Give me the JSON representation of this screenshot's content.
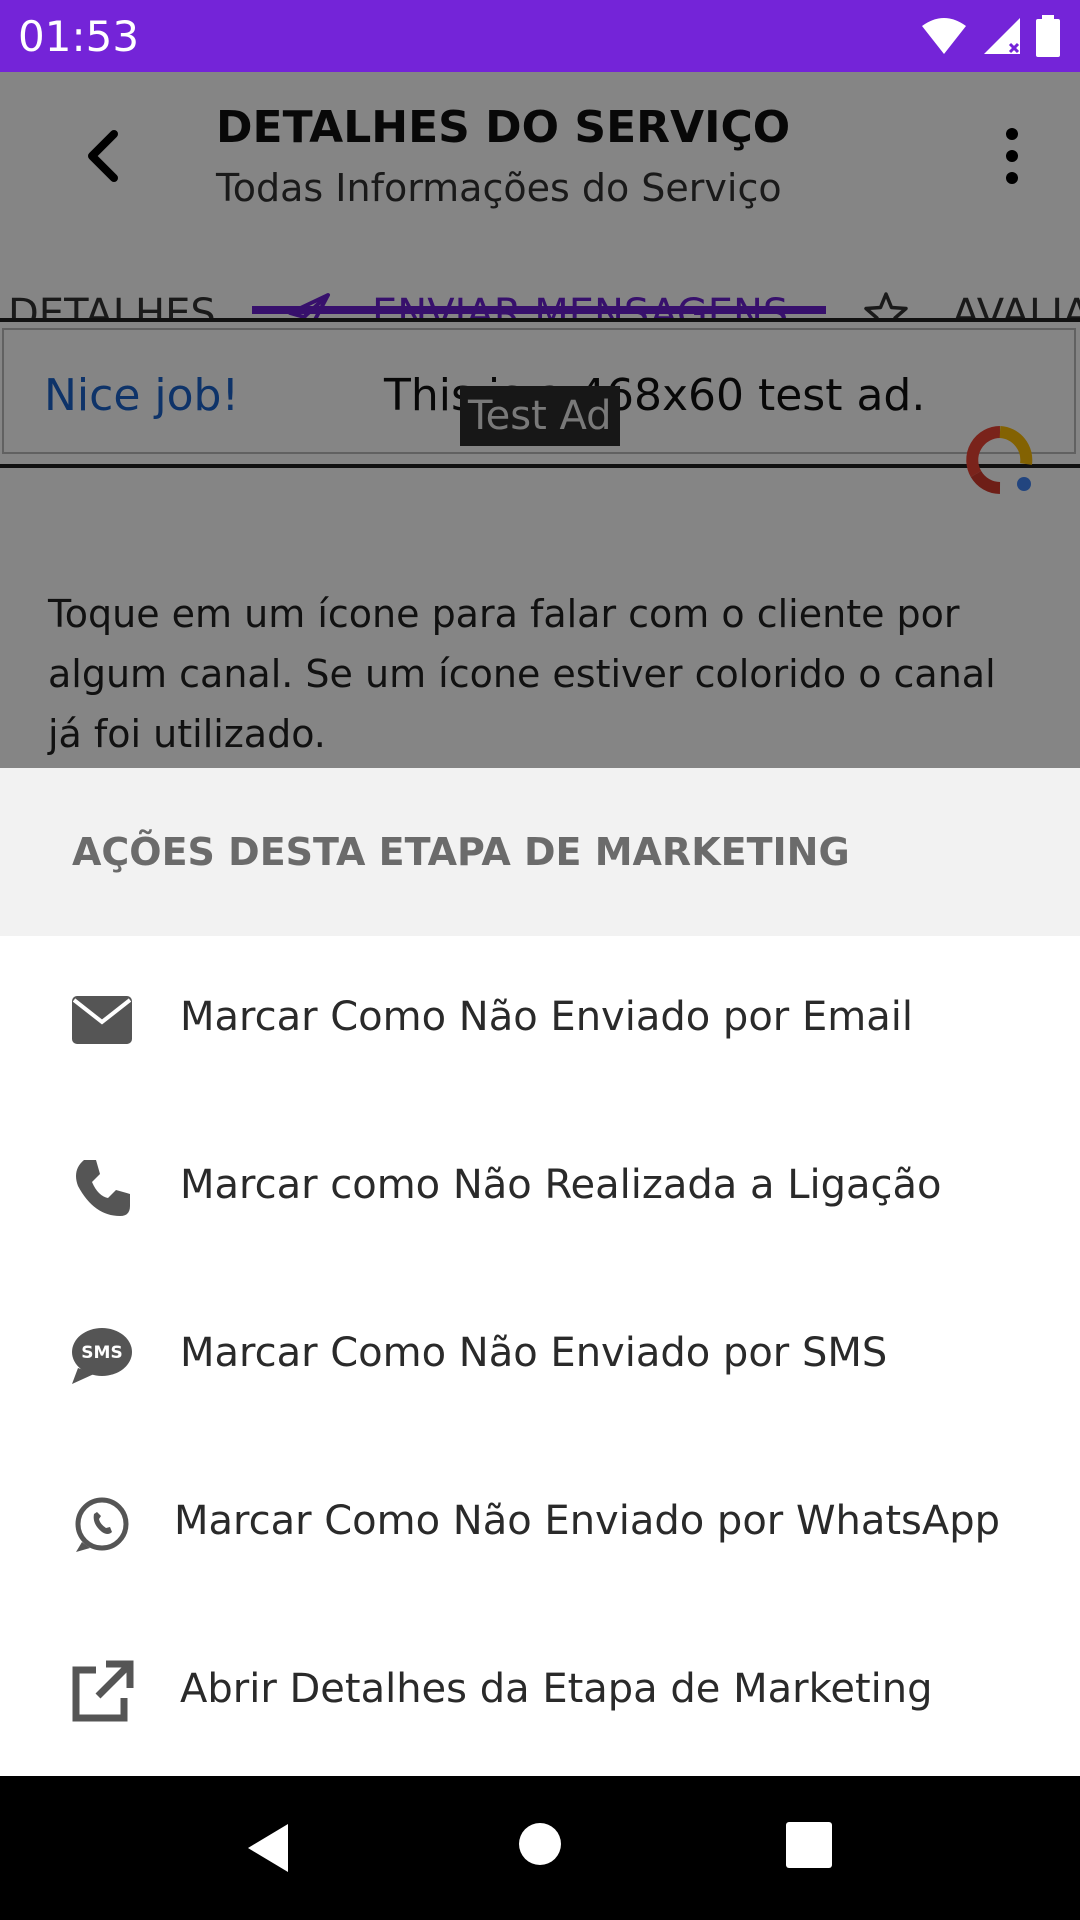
{
  "status_bar": {
    "time": "01:53",
    "icons": [
      "wifi-icon",
      "signal-icon",
      "battery-icon"
    ]
  },
  "toolbar": {
    "title": "DETALHES DO SERVIÇO",
    "subtitle": "Todas Informações do Serviço"
  },
  "tabs": [
    {
      "label": "DETALHES",
      "icon": "",
      "active": false
    },
    {
      "label": "ENVIAR MENSAGENS",
      "icon": "send-icon",
      "active": true
    },
    {
      "label": "AVALIA",
      "icon": "star-icon",
      "active": false
    }
  ],
  "ad": {
    "label": "Test Ad",
    "nice": "Nice job!",
    "text": "This is a 468x60 test ad."
  },
  "info_text": "Toque em um ícone para falar com o cliente por algum canal. Se um ícone estiver colorido o canal já foi utilizado.",
  "sheet": {
    "title": "AÇÕES DESTA ETAPA DE MARKETING",
    "actions": [
      {
        "label": "Marcar Como Não Enviado por Email",
        "icon": "email-icon"
      },
      {
        "label": "Marcar como Não Realizada a Ligação",
        "icon": "phone-icon"
      },
      {
        "label": "Marcar Como Não Enviado por SMS",
        "icon": "sms-icon"
      },
      {
        "label": "Marcar Como Não Enviado por WhatsApp",
        "icon": "whatsapp-icon"
      },
      {
        "label": "Abrir Detalhes da Etapa de Marketing",
        "icon": "external-link-icon"
      }
    ]
  },
  "colors": {
    "status_bar": "#7424d8",
    "accent": "#6a1fd0"
  }
}
